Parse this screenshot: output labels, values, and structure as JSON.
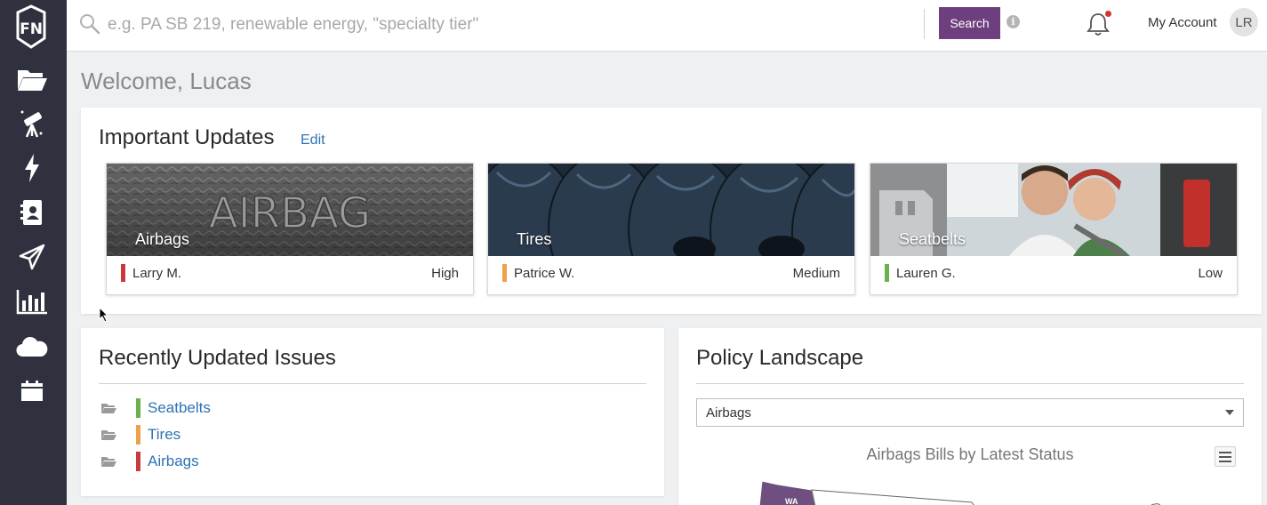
{
  "sidebar": {
    "logo_text": "FN",
    "items": [
      {
        "icon": "folder-open-icon"
      },
      {
        "icon": "telescope-icon"
      },
      {
        "icon": "lightning-icon"
      },
      {
        "icon": "contact-book-icon"
      },
      {
        "icon": "paper-plane-icon"
      },
      {
        "icon": "bar-chart-icon"
      },
      {
        "icon": "cloud-icon"
      },
      {
        "icon": "calendar-icon"
      }
    ],
    "bg_color": "#30313f"
  },
  "header": {
    "search_placeholder": "e.g. PA SB 219, renewable energy, \"specialty tier\"",
    "search_value": "",
    "search_button": "Search",
    "info_glyph": "i",
    "account_label": "My Account",
    "avatar_initials": "LR",
    "accent_color": "#6e3f7e"
  },
  "welcome": "Welcome, Lucas",
  "important_updates": {
    "title": "Important Updates",
    "edit_label": "Edit",
    "cards": [
      {
        "topic": "Airbags",
        "person": "Larry M.",
        "priority": "High",
        "priority_color": "#c9393d",
        "image_text": "AIRBAG"
      },
      {
        "topic": "Tires",
        "person": "Patrice W.",
        "priority": "Medium",
        "priority_color": "#f0a04b"
      },
      {
        "topic": "Seatbelts",
        "person": "Lauren G.",
        "priority": "Low",
        "priority_color": "#6ab04c"
      }
    ]
  },
  "recent_issues": {
    "title": "Recently Updated Issues",
    "items": [
      {
        "label": "Seatbelts",
        "color": "#6ab04c"
      },
      {
        "label": "Tires",
        "color": "#f0a04b"
      },
      {
        "label": "Airbags",
        "color": "#c9393d"
      }
    ]
  },
  "policy_landscape": {
    "title": "Policy Landscape",
    "selected": "Airbags",
    "chart_title": "Airbags Bills by Latest Status",
    "map_state_label": "WA",
    "map_color": "#6e4f80"
  }
}
